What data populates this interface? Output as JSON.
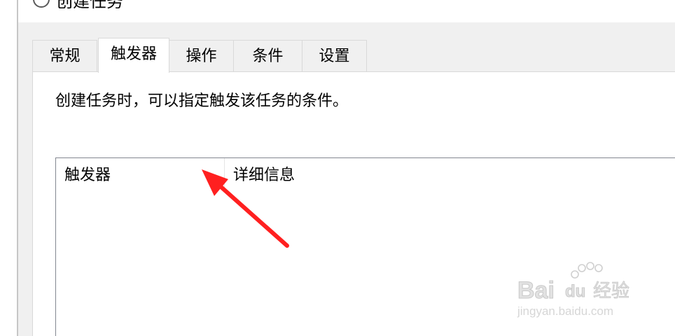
{
  "window": {
    "title": "创建任务",
    "icon": "clock-icon"
  },
  "tabs": [
    {
      "label": "常规",
      "active": false
    },
    {
      "label": "触发器",
      "active": true
    },
    {
      "label": "操作",
      "active": false
    },
    {
      "label": "条件",
      "active": false
    },
    {
      "label": "设置",
      "active": false
    }
  ],
  "panel": {
    "description": "创建任务时，可以指定触发该任务的条件。",
    "list": {
      "columns": [
        "触发器",
        "详细信息"
      ],
      "rows": []
    }
  },
  "annotation": {
    "type": "red-arrow",
    "color": "#ff2020",
    "points_to": "触发器"
  },
  "watermark": {
    "brand": "Bai du 经验",
    "url": "jingyan.baidu.com"
  }
}
